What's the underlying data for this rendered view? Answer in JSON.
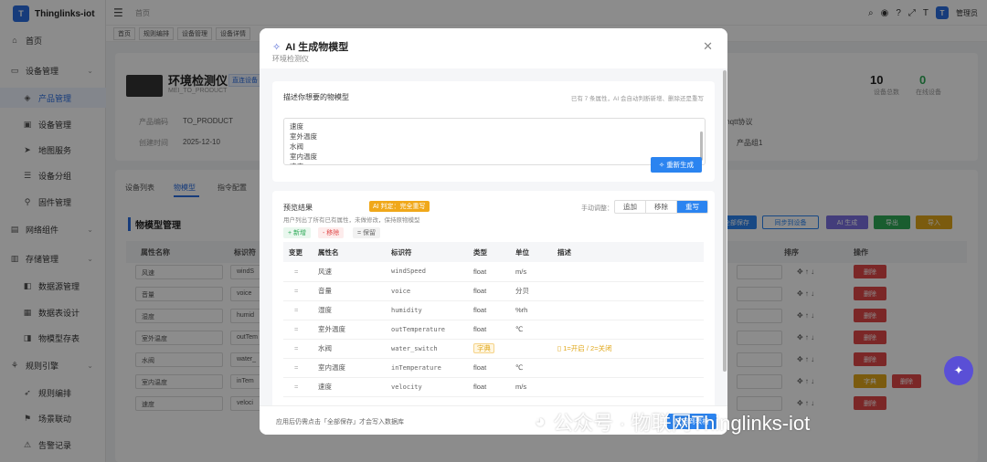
{
  "app": {
    "name": "Thinglinks-iot",
    "logo_text": "T",
    "user": "管理员",
    "breadcrumb": "首页"
  },
  "sidebar": {
    "items": [
      {
        "label": "首页",
        "icon": "dashboard-icon",
        "level": "top"
      },
      {
        "label": "设备管理",
        "icon": "monitor-icon",
        "level": "top"
      },
      {
        "label": "产品管理",
        "icon": "product-icon",
        "level": "sub",
        "active": true
      },
      {
        "label": "设备管理",
        "icon": "device-icon",
        "level": "sub"
      },
      {
        "label": "地图服务",
        "icon": "map-icon",
        "level": "sub"
      },
      {
        "label": "设备分组",
        "icon": "group-icon",
        "level": "sub"
      },
      {
        "label": "固件管理",
        "icon": "firmware-icon",
        "level": "sub"
      },
      {
        "label": "网络组件",
        "icon": "network-icon",
        "level": "top"
      },
      {
        "label": "存储管理",
        "icon": "storage-icon",
        "level": "top"
      },
      {
        "label": "数据源管理",
        "icon": "datasource-icon",
        "level": "sub"
      },
      {
        "label": "数据表设计",
        "icon": "table-icon",
        "level": "sub"
      },
      {
        "label": "物模型存表",
        "icon": "model-icon",
        "level": "sub"
      },
      {
        "label": "规则引擎",
        "icon": "rule-icon",
        "level": "top"
      },
      {
        "label": "规则编排",
        "icon": "flow-icon",
        "level": "sub"
      },
      {
        "label": "场景联动",
        "icon": "scene-icon",
        "level": "sub"
      },
      {
        "label": "告警记录",
        "icon": "alarm-icon",
        "level": "sub"
      }
    ]
  },
  "tags": [
    "首页",
    "规则编排",
    "设备管理",
    "设备详情"
  ],
  "background": {
    "product_name": "环境检测仪",
    "product_id": "MEI_TO_PRODUCT",
    "badge": "直连设备",
    "stat1_value": "10",
    "stat1_label": "设备总数",
    "stat2_value": "0",
    "stat2_label": "在线设备",
    "field1_label": "产品编码",
    "field1_value": "TO_PRODUCT",
    "field2_label": "创建时间",
    "field2_value": "2025-12-10",
    "proto": "mqtt协议",
    "group": "产品组1",
    "tabs": [
      "设备列表",
      "物模型",
      "指令配置"
    ],
    "section_title": "物模型管理",
    "col1": "属性名称",
    "col2": "标识符",
    "col_sort": "排序",
    "col_op": "操作",
    "rows": [
      "风速",
      "音量",
      "湿度",
      "室外温度",
      "水阀",
      "室内温度",
      "速度"
    ],
    "ids": [
      "windS",
      "voice",
      "humid",
      "outTem",
      "water_",
      "inTem",
      "veloci"
    ],
    "btn_save": "全部保存",
    "btn_sync": "同步到设备",
    "btn_ai": "AI 生成",
    "btn_export": "导出",
    "btn_import": "导入",
    "del": "删除",
    "edit": "字典"
  },
  "modal": {
    "title": "AI 生成物模型",
    "subtitle": "环境检测仪",
    "desc_label": "描述你想要的物模型",
    "desc_hint": "已有 7 条属性，AI 会自动判断新增、删除还是重写",
    "desc_lines": [
      "速度",
      "室外温度",
      "水阀",
      "室内温度",
      "速度"
    ],
    "regen": "重新生成",
    "preview_label": "预览结果",
    "ai_badge": "AI 判定：完全重写",
    "preview_note": "用户列出了所有已有属性，未做修改，保持原物模型",
    "legend_add": "+ 新增",
    "legend_remove": "- 移除",
    "legend_keep": "= 保留",
    "manual_label": "手动调整：",
    "seg": [
      "追加",
      "移除",
      "重写"
    ],
    "cols": [
      "变更",
      "属性名",
      "标识符",
      "类型",
      "单位",
      "描述"
    ],
    "rows": [
      {
        "change": "=",
        "name": "风速",
        "id": "windSpeed",
        "type": "float",
        "unit": "m/s",
        "desc": ""
      },
      {
        "change": "=",
        "name": "音量",
        "id": "voice",
        "type": "float",
        "unit": "分贝",
        "desc": ""
      },
      {
        "change": "=",
        "name": "湿度",
        "id": "humidity",
        "type": "float",
        "unit": "%rh",
        "desc": ""
      },
      {
        "change": "=",
        "name": "室外温度",
        "id": "outTemperature",
        "type": "float",
        "unit": "℃",
        "desc": ""
      },
      {
        "change": "=",
        "name": "水阀",
        "id": "water_switch",
        "type": "字典",
        "unit": "",
        "desc": "1=开启 / 2=关闭"
      },
      {
        "change": "=",
        "name": "室内温度",
        "id": "inTemperature",
        "type": "float",
        "unit": "℃",
        "desc": ""
      },
      {
        "change": "=",
        "name": "速度",
        "id": "velocity",
        "type": "float",
        "unit": "m/s",
        "desc": ""
      }
    ],
    "footer_note": "应用后仍需点击「全部保存」才会写入数据库",
    "apply": "应用到表格"
  },
  "watermark": "公众号 · 物联网Thinglinks-iot"
}
